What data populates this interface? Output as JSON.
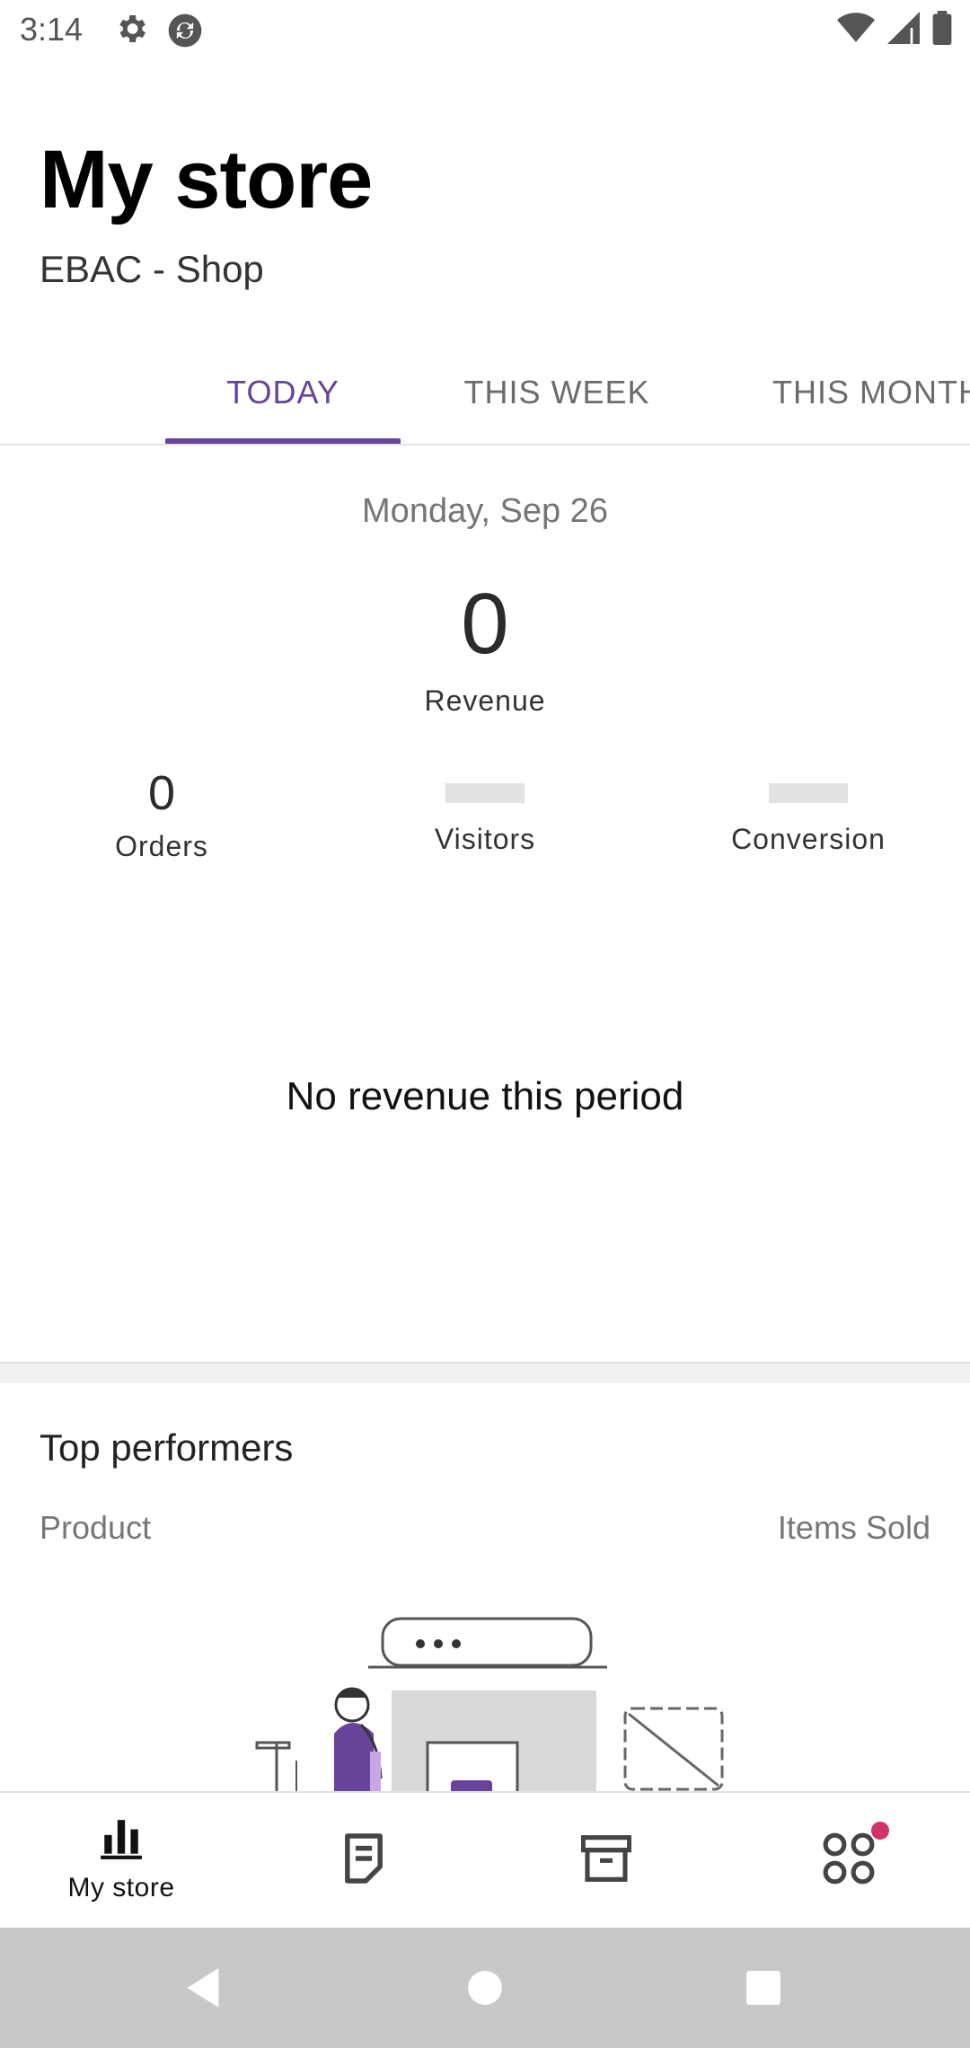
{
  "status_bar": {
    "time": "3:14",
    "icons": [
      "gear-icon",
      "sync-icon",
      "wifi-icon",
      "signal-icon",
      "battery-icon"
    ]
  },
  "header": {
    "title": "My store",
    "store_name": "EBAC - Shop"
  },
  "tabs": [
    {
      "label": "TODAY",
      "active": true
    },
    {
      "label": "THIS WEEK",
      "active": false
    },
    {
      "label": "THIS MONTH",
      "active": false
    }
  ],
  "stats": {
    "date": "Monday, Sep 26",
    "revenue_value": "0",
    "revenue_label": "Revenue",
    "orders_value": "0",
    "orders_label": "Orders",
    "visitors_label": "Visitors",
    "conversion_label": "Conversion",
    "empty_message": "No revenue this period"
  },
  "top_performers": {
    "title": "Top performers",
    "col_product": "Product",
    "col_items_sold": "Items Sold"
  },
  "bottom_nav": [
    {
      "label": "My store",
      "icon": "bar-chart-icon",
      "active": true
    },
    {
      "label": "",
      "icon": "orders-icon",
      "active": false
    },
    {
      "label": "",
      "icon": "archive-icon",
      "active": false
    },
    {
      "label": "",
      "icon": "more-menu-icon",
      "active": false,
      "badge": true
    }
  ],
  "colors": {
    "accent": "#674399",
    "badge": "#d0336a"
  }
}
